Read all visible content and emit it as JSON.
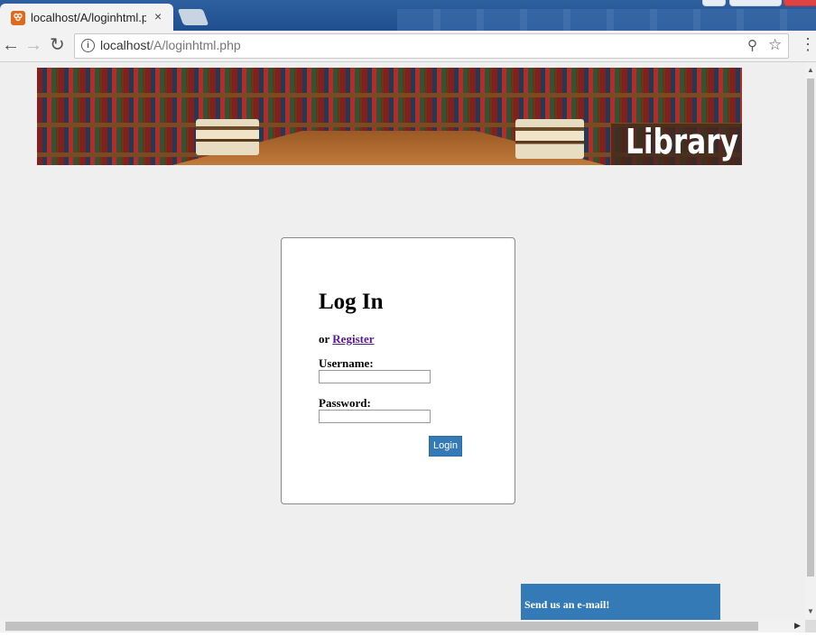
{
  "browser": {
    "tab_title": "localhost/A/loginhtml.php",
    "tab_favicon_glyph": "ꕢ",
    "tab_close": "×",
    "url_host": "localhost",
    "url_path": "/A/loginhtml.php",
    "icons": {
      "back": "back-arrow-icon",
      "forward": "forward-arrow-icon",
      "reload": "reload-icon",
      "info": "info-icon",
      "zoom": "zoom-icon",
      "star": "bookmark-star-icon",
      "menu": "kebab-menu-icon"
    }
  },
  "banner": {
    "logo_text": "Library"
  },
  "login": {
    "title": "Log In",
    "or_text": "or ",
    "register_link": "Register",
    "username_label": "Username:",
    "username_value": "",
    "password_label": "Password:",
    "password_value": "",
    "submit_label": "Login"
  },
  "footer": {
    "email_text": "Send us an e-mail!"
  },
  "colors": {
    "accent": "#337ab7",
    "page_bg": "#efefef",
    "link_visited": "#551a8b"
  }
}
